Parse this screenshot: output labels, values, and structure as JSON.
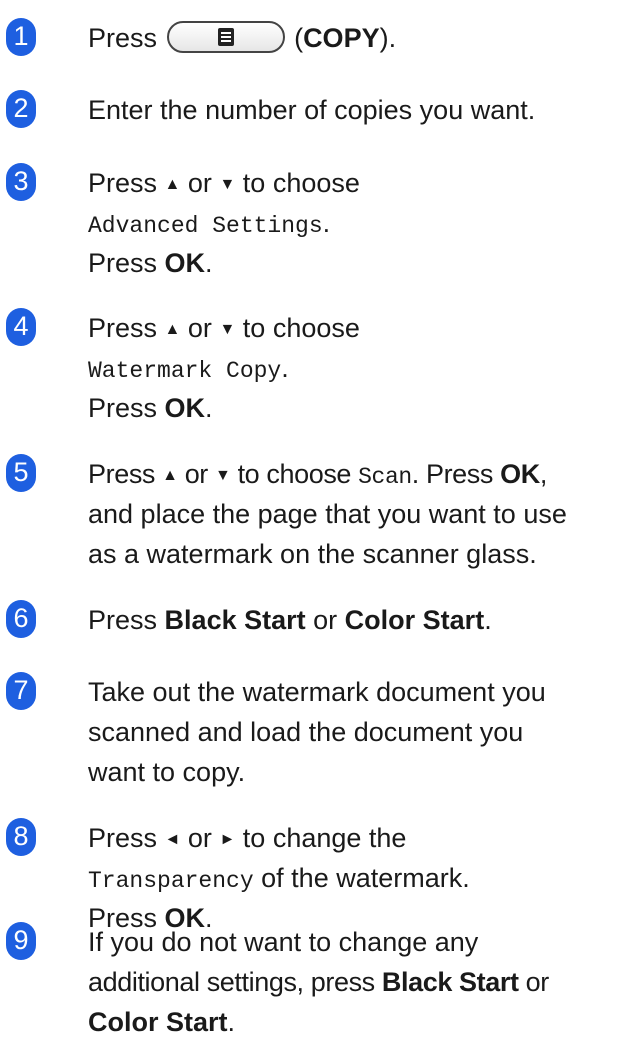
{
  "steps": [
    {
      "number": "1",
      "parts": {
        "press": "Press",
        "open": "(",
        "copy_key": "COPY",
        "close": ")."
      }
    },
    {
      "number": "2",
      "text": "Enter the number of copies you want."
    },
    {
      "number": "3",
      "press": "Press",
      "up": "▲",
      "or": "or",
      "down": "▼",
      "to_choose": "to choose",
      "setting": "Advanced Settings",
      "period": ".",
      "press2": "Press",
      "ok": "OK",
      "period2": "."
    },
    {
      "number": "4",
      "press": "Press",
      "up": "▲",
      "or": "or",
      "down": "▼",
      "to_choose": "to choose",
      "setting": "Watermark Copy",
      "period": ".",
      "press2": "Press",
      "ok": "OK",
      "period2": "."
    },
    {
      "number": "5",
      "press": "Press",
      "up": "▲",
      "or": "or",
      "down": "▼",
      "to_choose": "to choose",
      "setting": "Scan",
      "period": ".",
      "press2": "Press",
      "ok": "OK",
      "comma": ",",
      "line2": "and place the page that you want to use",
      "line3": "as a watermark on the scanner glass."
    },
    {
      "number": "6",
      "press": "Press",
      "black_start": "Black Start",
      "or": "or",
      "color_start": "Color Start",
      "period": "."
    },
    {
      "number": "7",
      "line1": "Take out the watermark document you",
      "line2": "scanned and load the document you",
      "line3": "want to copy."
    },
    {
      "number": "8",
      "press": "Press",
      "left": "◄",
      "or": "or",
      "right": "►",
      "to_change": "to change the",
      "setting": "Transparency",
      "of_watermark": "of the watermark.",
      "press2": "Press",
      "ok": "OK",
      "period2": "."
    },
    {
      "number": "9",
      "line1": "If you do not want to change any",
      "line2_pre": "additional settings, press",
      "black_start": "Black Start",
      "or": "or",
      "color_start": "Color Start",
      "period": "."
    }
  ],
  "icons": {
    "copy_button": "copy-key-icon"
  },
  "colors": {
    "step_badge": "#1e5fe0",
    "text": "#1a1a1a"
  }
}
